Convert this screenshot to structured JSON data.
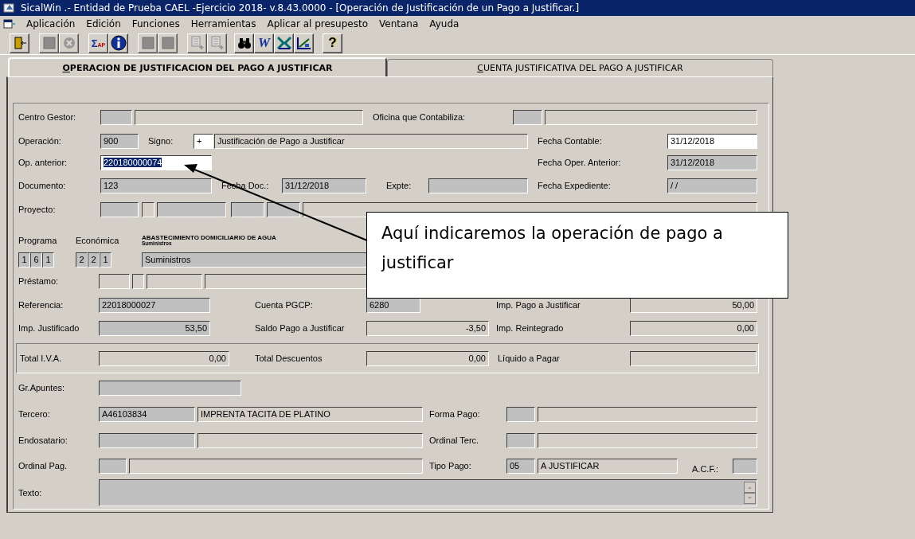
{
  "window": {
    "title": "SicalWin .- Entidad de Prueba CAEL -Ejercicio 2018- v.8.43.0000 - [Operación de Justificación de un Pago a Justificar.]"
  },
  "menu": [
    "Aplicación",
    "Edición",
    "Funciones",
    "Herramientas",
    "Aplicar al presupesto",
    "Ventana",
    "Ayuda"
  ],
  "toolbar": [
    {
      "kind": "exit",
      "disabled": false
    },
    {
      "kind": "square",
      "disabled": true
    },
    {
      "kind": "cancel",
      "disabled": true
    },
    {
      "kind": "sigma",
      "disabled": false,
      "glyph": "Σ",
      "sub": "AP"
    },
    {
      "kind": "info",
      "disabled": false
    },
    {
      "kind": "square",
      "disabled": true
    },
    {
      "kind": "square",
      "disabled": true
    },
    {
      "kind": "sheet-add",
      "disabled": true
    },
    {
      "kind": "list-add",
      "disabled": true
    },
    {
      "kind": "binoculars",
      "disabled": false
    },
    {
      "kind": "word",
      "disabled": false,
      "glyph": "W"
    },
    {
      "kind": "excel",
      "disabled": false
    },
    {
      "kind": "chart",
      "disabled": false
    },
    {
      "kind": "help",
      "disabled": false,
      "glyph": "?"
    }
  ],
  "tabs": [
    {
      "label": "OPERACION DE JUSTIFICACION DEL PAGO A JUSTIFICAR",
      "selected": true
    },
    {
      "label": "CUENTA JUSTIFICATIVA DEL PAGO A JUSTIFICAR",
      "selected": false
    }
  ],
  "form": {
    "rows": [
      {
        "items": [
          {
            "kind": "label",
            "text": "Centro Gestor:"
          },
          {
            "kind": "field",
            "disabled": true
          },
          {
            "kind": "field",
            "disabled": false,
            "readonly": true
          },
          {
            "kind": "label",
            "text": "Oficina que Contabiliza:"
          },
          {
            "kind": "field",
            "disabled": true
          },
          {
            "kind": "field",
            "disabled": false,
            "readonly": true
          }
        ]
      },
      {
        "items": [
          {
            "kind": "label",
            "text": "Operación:"
          },
          {
            "kind": "field",
            "disabled": true,
            "value": "900"
          },
          {
            "kind": "label",
            "text": "Signo:"
          },
          {
            "kind": "field",
            "disabled": false,
            "readonly": false,
            "highlighted": false,
            "value": "+"
          },
          {
            "kind": "field",
            "disabled": false,
            "readonly": true,
            "value": "Justificación de Pago a Justificar"
          },
          {
            "kind": "label",
            "text": "Fecha Contable:"
          },
          {
            "kind": "field",
            "disabled": false,
            "readonly": false,
            "highlighted": false,
            "value": "31/12/2018"
          }
        ]
      },
      {
        "items": [
          {
            "kind": "label",
            "text": "Op. anterior:"
          },
          {
            "kind": "field",
            "disabled": false,
            "readonly": false,
            "highlighted": true,
            "value": "220180000074"
          },
          {
            "kind": "label",
            "text": "Fecha Oper. Anterior:"
          },
          {
            "kind": "field",
            "disabled": true,
            "value": "31/12/2018"
          }
        ]
      },
      {
        "items": [
          {
            "kind": "label",
            "text": "Documento:"
          },
          {
            "kind": "field",
            "disabled": true,
            "value": "123"
          },
          {
            "kind": "label",
            "text": "Fecha Doc.:"
          },
          {
            "kind": "field",
            "disabled": true,
            "value": "31/12/2018"
          },
          {
            "kind": "label",
            "text": "Expte:"
          },
          {
            "kind": "field",
            "disabled": true
          },
          {
            "kind": "label",
            "text": "Fecha Expediente:"
          },
          {
            "kind": "field",
            "disabled": true,
            "value": "/ /"
          }
        ]
      },
      {
        "items": [
          {
            "kind": "label",
            "text": "Proyecto:"
          },
          {
            "kind": "field",
            "disabled": true
          },
          {
            "kind": "field",
            "disabled": false,
            "readonly": true
          },
          {
            "kind": "field",
            "disabled": true
          },
          {
            "kind": "field",
            "disabled": true
          },
          {
            "kind": "field",
            "disabled": true
          },
          {
            "kind": "field",
            "disabled": false,
            "readonly": true
          }
        ]
      },
      {
        "items": [
          {
            "kind": "label",
            "text": "Programa"
          },
          {
            "kind": "label",
            "text": "Económica"
          },
          {
            "kind": "caption",
            "text": "ABASTECIMIENTO DOMICILIARIO DE AGUA",
            "subtext": "Suministros"
          }
        ]
      },
      {
        "items": [
          {
            "kind": "digit",
            "value": "1"
          },
          {
            "kind": "digit",
            "value": "6"
          },
          {
            "kind": "digit",
            "value": "1"
          },
          {
            "kind": "digit",
            "value": "2"
          },
          {
            "kind": "digit",
            "value": "2"
          },
          {
            "kind": "digit",
            "value": "1"
          },
          {
            "kind": "field",
            "disabled": true,
            "value": "Suministros"
          }
        ]
      },
      {
        "items": [
          {
            "kind": "label",
            "text": "Préstamo:"
          },
          {
            "kind": "field",
            "disabled": false,
            "readonly": true
          },
          {
            "kind": "field",
            "disabled": false,
            "readonly": true
          },
          {
            "kind": "field",
            "disabled": false,
            "readonly": true
          },
          {
            "kind": "field",
            "disabled": false,
            "readonly": true
          }
        ]
      },
      {
        "items": [
          {
            "kind": "label",
            "text": "Referencia:"
          },
          {
            "kind": "field",
            "disabled": true,
            "value": "22018000027"
          },
          {
            "kind": "label",
            "text": "Cuenta PGCP:"
          },
          {
            "kind": "field",
            "disabled": true,
            "value": "6280"
          },
          {
            "kind": "label",
            "text": "Imp. Pago a Justificar"
          },
          {
            "kind": "field",
            "disabled": false,
            "readonly": true,
            "value": "50,00"
          }
        ]
      },
      {
        "items": [
          {
            "kind": "label",
            "text": "Imp. Justificado"
          },
          {
            "kind": "field",
            "disabled": true,
            "value": "53,50"
          },
          {
            "kind": "label",
            "text": "Saldo Pago a Justificar"
          },
          {
            "kind": "field",
            "disabled": false,
            "readonly": true,
            "value": "-3,50"
          },
          {
            "kind": "label",
            "text": "Imp. Reintegrado"
          },
          {
            "kind": "field",
            "disabled": false,
            "readonly": true,
            "value": "0,00"
          }
        ]
      },
      {
        "kind": "group",
        "items": [
          {
            "kind": "label",
            "text": "Total I.V.A."
          },
          {
            "kind": "field",
            "disabled": false,
            "readonly": true,
            "value": "0,00"
          },
          {
            "kind": "label",
            "text": "Total Descuentos"
          },
          {
            "kind": "field",
            "disabled": false,
            "readonly": true,
            "value": "0,00"
          },
          {
            "kind": "label",
            "text": "Líquido a Pagar"
          },
          {
            "kind": "field",
            "disabled": false,
            "readonly": true
          }
        ]
      },
      {
        "items": [
          {
            "kind": "label",
            "text": "Gr.Apuntes:"
          },
          {
            "kind": "field",
            "disabled": true
          }
        ]
      },
      {
        "items": [
          {
            "kind": "label",
            "text": "Tercero:"
          },
          {
            "kind": "field",
            "disabled": true,
            "value": "A46103834"
          },
          {
            "kind": "field",
            "disabled": false,
            "readonly": true,
            "value": "IMPRENTA TACITA DE PLATINO"
          },
          {
            "kind": "label",
            "text": "Forma Pago:"
          },
          {
            "kind": "field",
            "disabled": true
          },
          {
            "kind": "field",
            "disabled": false,
            "readonly": true
          }
        ]
      },
      {
        "items": [
          {
            "kind": "label",
            "text": "Endosatario:"
          },
          {
            "kind": "field",
            "disabled": true
          },
          {
            "kind": "field",
            "disabled": false,
            "readonly": true
          },
          {
            "kind": "label",
            "text": "Ordinal Terc."
          },
          {
            "kind": "field",
            "disabled": true
          },
          {
            "kind": "field",
            "disabled": false,
            "readonly": true
          }
        ]
      },
      {
        "items": [
          {
            "kind": "label",
            "text": "Ordinal Pag."
          },
          {
            "kind": "field",
            "disabled": true
          },
          {
            "kind": "field",
            "disabled": false,
            "readonly": true
          },
          {
            "kind": "label",
            "text": "Tipo Pago:"
          },
          {
            "kind": "field",
            "disabled": true,
            "value": "05"
          },
          {
            "kind": "field",
            "disabled": false,
            "readonly": true,
            "value": "A JUSTIFICAR"
          },
          {
            "kind": "label",
            "text": "A.C.F.:"
          },
          {
            "kind": "field",
            "disabled": true
          }
        ]
      },
      {
        "items": [
          {
            "kind": "label",
            "text": "Texto:"
          },
          {
            "kind": "memo",
            "disabled": true
          }
        ]
      }
    ]
  },
  "callout": {
    "text": "Aquí indicaremos la operación de pago a justificar"
  }
}
